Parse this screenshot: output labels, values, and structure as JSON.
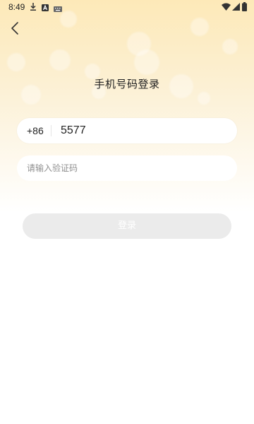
{
  "status_bar": {
    "time": "8:49",
    "icons": [
      "download-icon",
      "a-notification-icon",
      "keyboard-icon",
      "wifi-icon",
      "signal-icon",
      "battery-icon"
    ]
  },
  "header": {
    "back_icon": "chevron-left-icon",
    "title": "手机号码登录"
  },
  "form": {
    "country_code": "+86",
    "phone_value": "5577",
    "code_value": "",
    "code_placeholder": "请输入验证码",
    "login_label": "登录"
  },
  "colors": {
    "gradient_top": "#fde9b8",
    "gradient_bottom": "#ffffff",
    "button_bg": "#ebebeb",
    "button_text": "#ffffff",
    "placeholder": "#8f8f8f"
  }
}
